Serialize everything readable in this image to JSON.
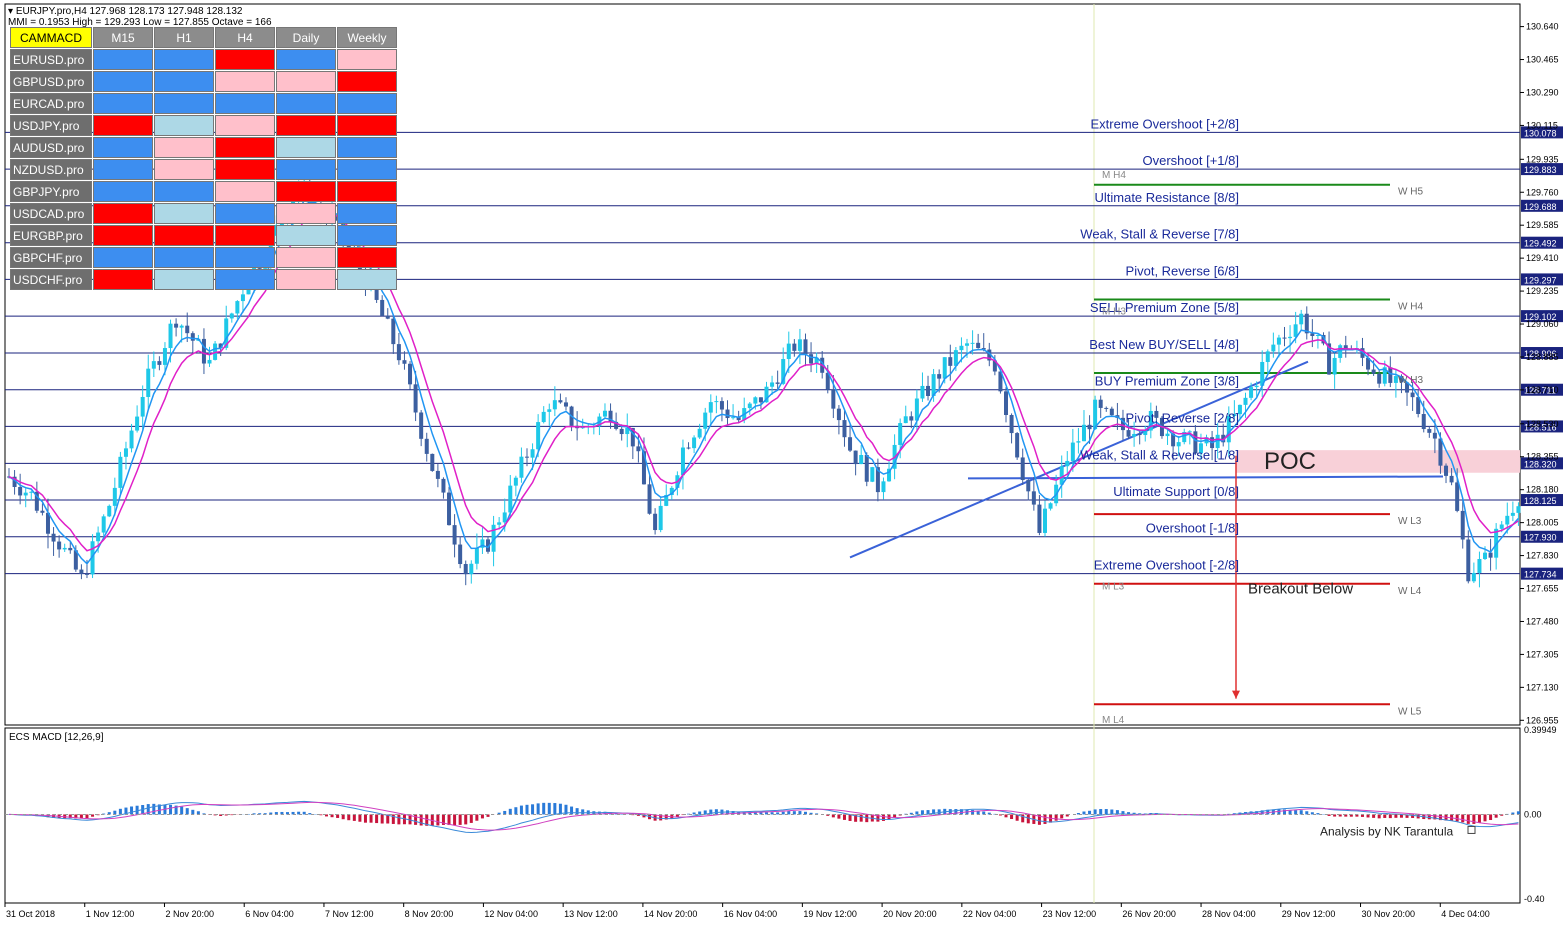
{
  "header": {
    "symbol_line": "EURJPY.pro,H4  127.968 128.173 127.948 128.132",
    "mmi_line": "MMI = 0.1953   High = 129.293   Low = 127.855   Octave = 166"
  },
  "colors": {
    "bull_candle": "#1ec8e8",
    "bear_candle": "#3c5fa0",
    "ma_fast": "#2196f3",
    "ma_slow": "#e020c8",
    "level_line": "#1a237e",
    "level_text": "#1a2a9a",
    "green_line": "#1a8a1a",
    "red_line": "#d01010",
    "poc_zone": "#f8d0d8",
    "macd_pos": "#2a7ad8",
    "macd_neg": "#c8143c",
    "strong_up": "#3d8ef0",
    "weak_up": "#add8e6",
    "weak_down": "#ffc0cb",
    "strong_down": "#ff0000"
  },
  "mtf_table": {
    "corner": "CAMMACD",
    "timeframes": [
      "M15",
      "H1",
      "H4",
      "Daily",
      "Weekly"
    ],
    "rows": [
      {
        "symbol": "EURUSD.pro",
        "cells": [
          "strong_up",
          "strong_up",
          "strong_down",
          "strong_up",
          "weak_down"
        ]
      },
      {
        "symbol": "GBPUSD.pro",
        "cells": [
          "strong_up",
          "strong_up",
          "weak_down",
          "weak_down",
          "strong_down"
        ]
      },
      {
        "symbol": "EURCAD.pro",
        "cells": [
          "strong_up",
          "strong_up",
          "strong_up",
          "strong_up",
          "strong_up"
        ]
      },
      {
        "symbol": "USDJPY.pro",
        "cells": [
          "strong_down",
          "weak_up",
          "weak_down",
          "strong_down",
          "strong_down"
        ]
      },
      {
        "symbol": "AUDUSD.pro",
        "cells": [
          "strong_up",
          "weak_down",
          "strong_down",
          "weak_up",
          "strong_up"
        ]
      },
      {
        "symbol": "NZDUSD.pro",
        "cells": [
          "strong_up",
          "weak_down",
          "strong_down",
          "strong_up",
          "strong_up"
        ]
      },
      {
        "symbol": "GBPJPY.pro",
        "cells": [
          "strong_up",
          "strong_up",
          "weak_down",
          "strong_down",
          "strong_down"
        ]
      },
      {
        "symbol": "USDCAD.pro",
        "cells": [
          "strong_down",
          "weak_up",
          "strong_up",
          "weak_down",
          "strong_up"
        ]
      },
      {
        "symbol": "EURGBP.pro",
        "cells": [
          "strong_down",
          "strong_down",
          "strong_down",
          "weak_up",
          "strong_up"
        ]
      },
      {
        "symbol": "GBPCHF.pro",
        "cells": [
          "strong_up",
          "strong_up",
          "strong_up",
          "weak_down",
          "strong_down"
        ]
      },
      {
        "symbol": "USDCHF.pro",
        "cells": [
          "strong_down",
          "weak_up",
          "strong_up",
          "weak_down",
          "weak_up"
        ]
      }
    ]
  },
  "chart_data": [
    {
      "type": "candlestick",
      "symbol": "EURJPY.pro",
      "timeframe": "H4",
      "ylim": [
        126.93,
        130.76
      ],
      "y_ticks": [
        "130.640",
        "130.465",
        "130.290",
        "130.115",
        "129.935",
        "129.760",
        "129.585",
        "129.410",
        "129.235",
        "129.060",
        "128.885",
        "128.710",
        "128.530",
        "128.355",
        "128.180",
        "128.005",
        "127.830",
        "127.655",
        "127.480",
        "127.305",
        "127.130",
        "126.955"
      ],
      "x_ticks": [
        "31 Oct 2018",
        "1 Nov 12:00",
        "2 Nov 20:00",
        "6 Nov 04:00",
        "7 Nov 12:00",
        "8 Nov 20:00",
        "12 Nov 04:00",
        "13 Nov 12:00",
        "14 Nov 20:00",
        "16 Nov 04:00",
        "19 Nov 12:00",
        "20 Nov 20:00",
        "22 Nov 04:00",
        "23 Nov 12:00",
        "26 Nov 20:00",
        "28 Nov 04:00",
        "29 Nov 12:00",
        "30 Nov 20:00",
        "4 Dec 04:00"
      ],
      "price_path": [
        [
          0,
          128.25
        ],
        [
          4,
          128.15
        ],
        [
          8,
          127.95
        ],
        [
          13,
          127.7
        ],
        [
          18,
          128.1
        ],
        [
          24,
          128.7
        ],
        [
          30,
          129.1
        ],
        [
          36,
          128.85
        ],
        [
          42,
          129.25
        ],
        [
          47,
          129.5
        ],
        [
          52,
          129.8
        ],
        [
          58,
          129.6
        ],
        [
          64,
          129.3
        ],
        [
          70,
          128.9
        ],
        [
          76,
          128.3
        ],
        [
          82,
          127.75
        ],
        [
          86,
          127.9
        ],
        [
          92,
          128.3
        ],
        [
          97,
          128.65
        ],
        [
          103,
          128.5
        ],
        [
          108,
          128.6
        ],
        [
          112,
          128.45
        ],
        [
          116,
          127.95
        ],
        [
          121,
          128.4
        ],
        [
          126,
          128.65
        ],
        [
          131,
          128.55
        ],
        [
          136,
          128.7
        ],
        [
          141,
          128.95
        ],
        [
          146,
          128.85
        ],
        [
          151,
          128.4
        ],
        [
          156,
          128.2
        ],
        [
          161,
          128.55
        ],
        [
          167,
          128.8
        ],
        [
          172,
          128.95
        ],
        [
          177,
          128.85
        ],
        [
          180,
          128.5
        ],
        [
          185,
          127.95
        ],
        [
          190,
          128.35
        ],
        [
          195,
          128.6
        ],
        [
          200,
          128.5
        ],
        [
          205,
          128.55
        ],
        [
          210,
          128.45
        ],
        [
          216,
          128.4
        ],
        [
          221,
          128.6
        ],
        [
          227,
          128.95
        ],
        [
          232,
          129.1
        ],
        [
          237,
          128.85
        ],
        [
          240,
          128.95
        ],
        [
          244,
          128.85
        ],
        [
          248,
          128.75
        ],
        [
          252,
          128.65
        ],
        [
          256,
          128.45
        ],
        [
          259,
          128.2
        ],
        [
          262,
          127.75
        ],
        [
          265,
          127.8
        ],
        [
          268,
          128.0
        ],
        [
          271,
          128.15
        ]
      ],
      "ma_lines": [
        {
          "name": "fast",
          "color": "ma_fast"
        },
        {
          "name": "slow",
          "color": "ma_slow"
        }
      ],
      "murrey_levels": [
        {
          "price": 130.078,
          "label": "Extreme Overshoot [+2/8]"
        },
        {
          "price": 129.883,
          "label": "Overshoot [+1/8]"
        },
        {
          "price": 129.688,
          "label": "Ultimate Resistance [8/8]"
        },
        {
          "price": 129.492,
          "label": "Weak, Stall & Reverse [7/8]"
        },
        {
          "price": 129.297,
          "label": "Pivot, Reverse [6/8]"
        },
        {
          "price": 129.102,
          "label": "SELL Premium Zone [5/8]"
        },
        {
          "price": 128.906,
          "label": "Best New BUY/SELL [4/8]"
        },
        {
          "price": 128.711,
          "label": "BUY Premium Zone [3/8]"
        },
        {
          "price": 128.516,
          "label": "Pivot, Reverse [2/8]"
        },
        {
          "price": 128.32,
          "label": "Weak, Stall & Reverse [1/8]"
        },
        {
          "price": 128.125,
          "label": "Ultimate Support [0/8]"
        },
        {
          "price": 127.93,
          "label": "Overshoot [-1/8]"
        },
        {
          "price": 127.734,
          "label": "Extreme Overshoot [-2/8]"
        }
      ],
      "weekly_levels": [
        {
          "price": 129.8,
          "label": "W H5",
          "color": "green_line"
        },
        {
          "price": 129.19,
          "label": "W H4",
          "color": "green_line"
        },
        {
          "price": 128.8,
          "label": "W H3",
          "color": "green_line"
        },
        {
          "price": 128.05,
          "label": "W L3",
          "color": "red_line"
        },
        {
          "price": 127.68,
          "label": "W L4",
          "color": "red_line"
        },
        {
          "price": 127.04,
          "label": "W L5",
          "color": "red_line"
        }
      ],
      "monthly_labels": [
        {
          "price": 129.835,
          "label": "M H4"
        },
        {
          "price": 129.11,
          "label": "M H3"
        },
        {
          "price": 127.65,
          "label": "M L3"
        },
        {
          "price": 126.94,
          "label": "M L4"
        }
      ],
      "annotations": {
        "poc_label": "POC",
        "poc_range": [
          128.27,
          128.39
        ],
        "breakout_label": "Breakout Below",
        "breakout_arrow_from": 128.36,
        "breakout_arrow_to": 127.07
      }
    },
    {
      "type": "bar",
      "title": "ECS MACD [12,26,9]",
      "ylim": [
        -0.42,
        0.41
      ],
      "y_ticks": [
        "0.39949",
        "0.00",
        "-0.40"
      ],
      "watermark": "Analysis by NK Tarantula"
    }
  ]
}
